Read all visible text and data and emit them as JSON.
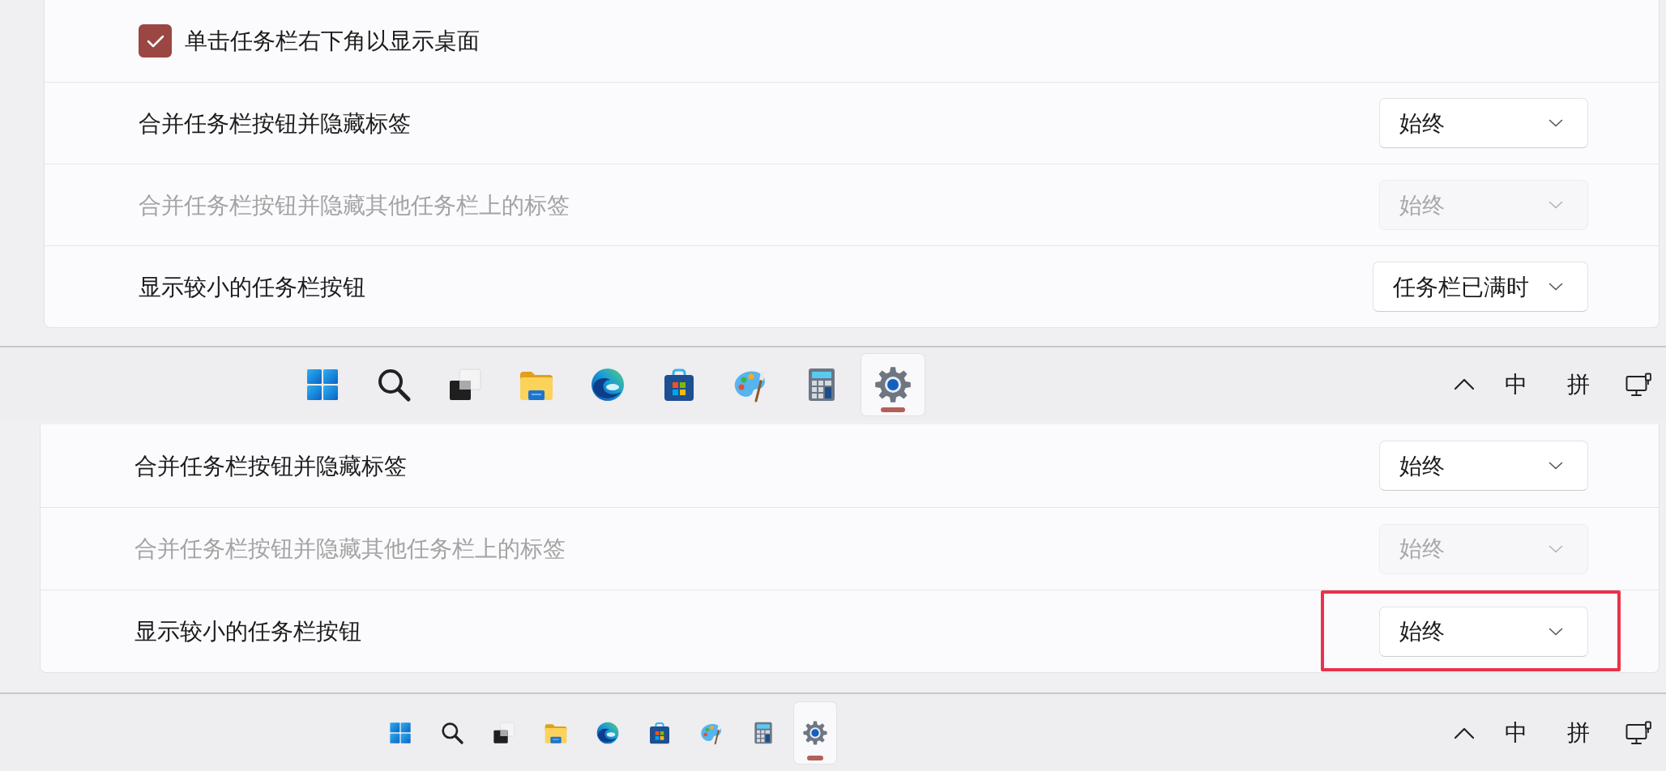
{
  "panels": [
    {
      "settings": [
        {
          "kind": "checkbox",
          "label": "单击任务栏右下角以显示桌面",
          "checked": true,
          "highlighted": false
        },
        {
          "kind": "dropdown",
          "label": "合并任务栏按钮并隐藏标签",
          "value": "始终",
          "disabled": false,
          "highlighted": false
        },
        {
          "kind": "dropdown",
          "label": "合并任务栏按钮并隐藏其他任务栏上的标签",
          "value": "始终",
          "disabled": true,
          "highlighted": false
        },
        {
          "kind": "dropdown",
          "label": "显示较小的任务栏按钮",
          "value": "任务栏已满时",
          "disabled": false,
          "highlighted": false
        }
      ],
      "taskbar": {
        "small_buttons": false,
        "apps": [
          {
            "selected": false
          },
          {
            "selected": false
          },
          {
            "selected": false
          },
          {
            "selected": false
          },
          {
            "selected": false
          },
          {
            "selected": false
          },
          {
            "selected": false
          },
          {
            "selected": false
          },
          {
            "selected": true
          }
        ],
        "input_indicators": [
          "中",
          "拼"
        ]
      }
    },
    {
      "settings": [
        {
          "kind": "dropdown",
          "label": "合并任务栏按钮并隐藏标签",
          "value": "始终",
          "disabled": false,
          "highlighted": false
        },
        {
          "kind": "dropdown",
          "label": "合并任务栏按钮并隐藏其他任务栏上的标签",
          "value": "始终",
          "disabled": true,
          "highlighted": false
        },
        {
          "kind": "dropdown",
          "label": "显示较小的任务栏按钮",
          "value": "始终",
          "disabled": false,
          "highlighted": true
        }
      ],
      "taskbar": {
        "small_buttons": true,
        "apps": [
          {
            "selected": false
          },
          {
            "selected": false
          },
          {
            "selected": false
          },
          {
            "selected": false
          },
          {
            "selected": false
          },
          {
            "selected": false
          },
          {
            "selected": false
          },
          {
            "selected": false
          },
          {
            "selected": true
          }
        ],
        "input_indicators": [
          "中",
          "拼"
        ]
      }
    }
  ]
}
